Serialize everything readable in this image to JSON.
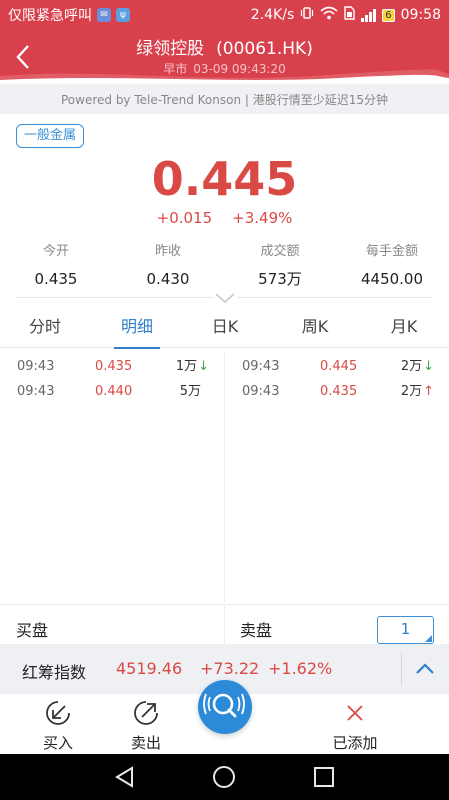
{
  "status_bar": {
    "carrier_text": "仅限紧急呼叫",
    "speed": "2.4K/s",
    "battery": "6",
    "time": "09:58"
  },
  "header": {
    "stock_name": "绿领控股",
    "stock_code": "(00061.HK)",
    "session": "早市",
    "datetime": "03-09  09:43:20"
  },
  "powered_text": "Powered by Tele-Trend Konson | 港股行情至少延迟15分钟",
  "quote": {
    "tag": "一般金属",
    "price": "0.445",
    "change": "+0.015",
    "change_pct": "+3.49%",
    "up_color": "#d94a45",
    "stats": [
      {
        "label": "今开",
        "value": "0.435"
      },
      {
        "label": "昨收",
        "value": "0.430"
      },
      {
        "label": "成交额",
        "value": "573万"
      },
      {
        "label": "每手金额",
        "value": "4450.00"
      }
    ]
  },
  "tabs": [
    "分时",
    "明细",
    "日K",
    "周K",
    "月K"
  ],
  "active_tab": "明细",
  "trades_left": [
    {
      "time": "09:43",
      "price": "0.435",
      "volume": "1万",
      "dir": "down"
    },
    {
      "time": "09:43",
      "price": "0.440",
      "volume": "5万",
      "dir": ""
    }
  ],
  "trades_right": [
    {
      "time": "09:43",
      "price": "0.445",
      "volume": "2万",
      "dir": "down"
    },
    {
      "time": "09:43",
      "price": "0.435",
      "volume": "2万",
      "dir": "up"
    }
  ],
  "order_book": {
    "bid_label": "买盘",
    "ask_label": "卖盘",
    "levels": "1"
  },
  "index_bar": {
    "name": "红筹指数",
    "value": "4519.46",
    "change": "+73.22",
    "change_pct": "+1.62%"
  },
  "actions": {
    "buy": "买入",
    "sell": "卖出",
    "added": "已添加"
  },
  "accent_color": "#2d8ad8",
  "header_color": "#d8404c"
}
